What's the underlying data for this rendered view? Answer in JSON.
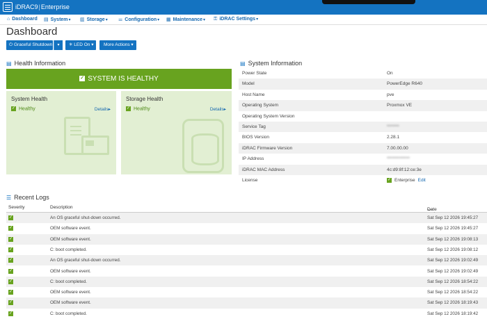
{
  "header": {
    "product": "iDRAC9",
    "edition": "Enterprise"
  },
  "nav": [
    {
      "label": "Dashboard",
      "icon": "home-icon",
      "has_menu": false
    },
    {
      "label": "System",
      "icon": "server-icon",
      "has_menu": true
    },
    {
      "label": "Storage",
      "icon": "storage-icon",
      "has_menu": true
    },
    {
      "label": "Configuration",
      "icon": "sliders-icon",
      "has_menu": true
    },
    {
      "label": "Maintenance",
      "icon": "wrench-icon",
      "has_menu": true
    },
    {
      "label": "iDRAC Settings",
      "icon": "key-icon",
      "has_menu": true
    }
  ],
  "page_title": "Dashboard",
  "actions": {
    "graceful_shutdown": "Graceful Shutdown",
    "led": "LED On",
    "more_actions": "More Actions"
  },
  "health": {
    "title": "Health Information",
    "banner": "SYSTEM IS HEALTHY",
    "system": {
      "title": "System Health",
      "status": "Healthy",
      "details": "Details"
    },
    "storage": {
      "title": "Storage Health",
      "status": "Healthy",
      "details": "Details"
    }
  },
  "system_info": {
    "title": "System Information",
    "rows": [
      {
        "label": "Power State",
        "value": "On"
      },
      {
        "label": "Model",
        "value": "PowerEdge R640"
      },
      {
        "label": "Host Name",
        "value": "pve"
      },
      {
        "label": "Operating System",
        "value": "Proxmox VE"
      },
      {
        "label": "Operating System Version",
        "value": ""
      },
      {
        "label": "Service Tag",
        "value": "*******"
      },
      {
        "label": "BIOS Version",
        "value": "2.28.1"
      },
      {
        "label": "iDRAC Firmware Version",
        "value": "7.00.00.00"
      },
      {
        "label": "IP Address",
        "value": "*************"
      },
      {
        "label": "iDRAC MAC Address",
        "value": "4c:d9:8f:12:ce:3e"
      },
      {
        "label": "License",
        "value": "Enterprise",
        "edit": "Edit"
      }
    ]
  },
  "logs": {
    "title": "Recent Logs",
    "columns": {
      "severity": "Severity",
      "description": "Description",
      "datetime": "Date and Time"
    },
    "rows": [
      {
        "description": "An OS graceful shut-down occurred.",
        "datetime": "Sat Sep 12 2026 19:45:27"
      },
      {
        "description": "OEM software event.",
        "datetime": "Sat Sep 12 2026 19:45:27"
      },
      {
        "description": "OEM software event.",
        "datetime": "Sat Sep 12 2026 19:08:13"
      },
      {
        "description": "C: boot completed.",
        "datetime": "Sat Sep 12 2026 19:08:12"
      },
      {
        "description": "An OS graceful shut-down occurred.",
        "datetime": "Sat Sep 12 2026 19:02:49"
      },
      {
        "description": "OEM software event.",
        "datetime": "Sat Sep 12 2026 19:02:49"
      },
      {
        "description": "C: boot completed.",
        "datetime": "Sat Sep 12 2026 18:54:22"
      },
      {
        "description": "OEM software event.",
        "datetime": "Sat Sep 12 2026 18:54:22"
      },
      {
        "description": "OEM software event.",
        "datetime": "Sat Sep 12 2026 18:19:43"
      },
      {
        "description": "C: boot completed.",
        "datetime": "Sat Sep 12 2026 18:19:42"
      }
    ]
  },
  "colors": {
    "brand_blue": "#1473c1",
    "healthy_green": "#68a31f",
    "health_card_bg": "#e2efd3"
  }
}
